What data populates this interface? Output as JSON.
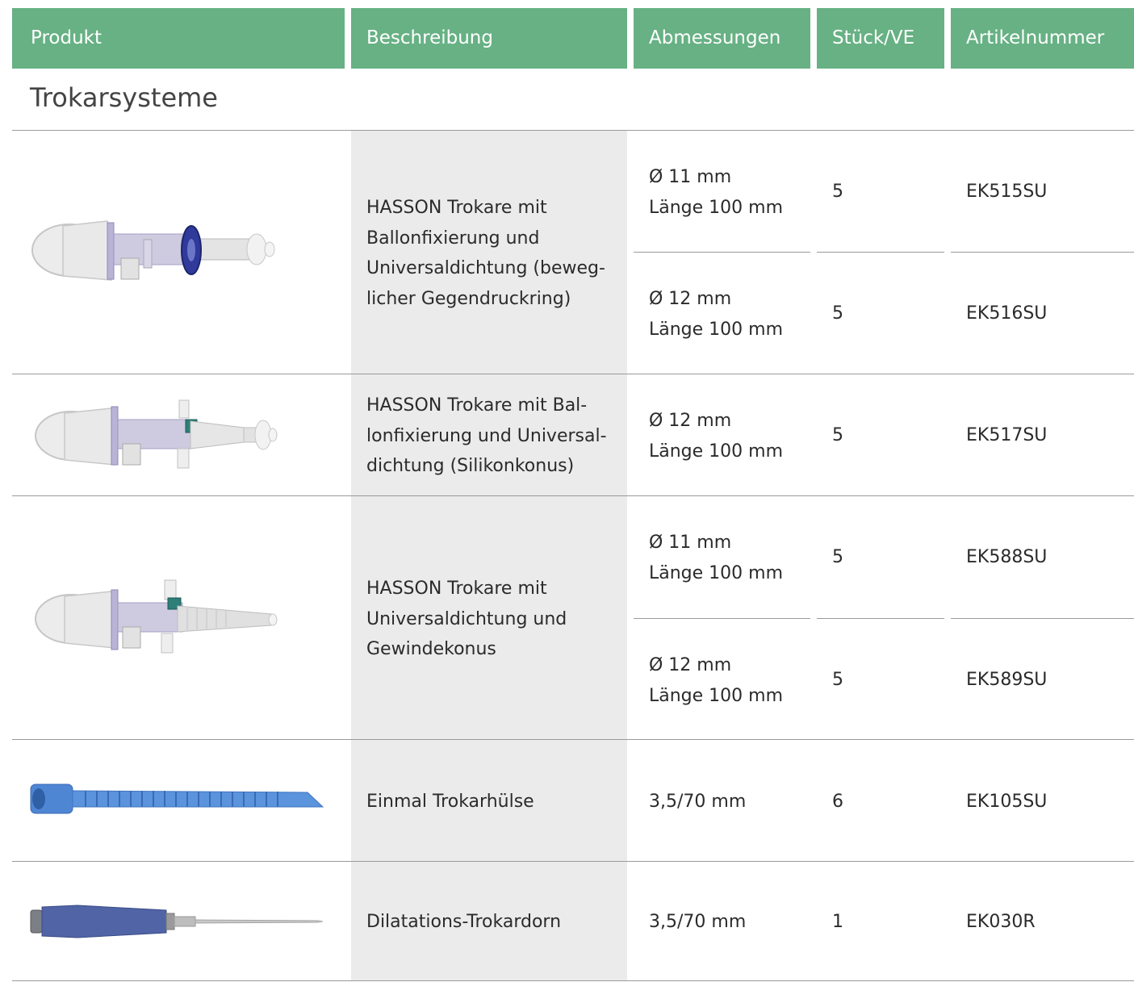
{
  "header": {
    "col_produkt": "Produkt",
    "col_beschreibung": "Beschreibung",
    "col_abmessungen": "Abmessungen",
    "col_stueck": "Stück/VE",
    "col_artikel": "Artikelnummer",
    "color": "#67b184"
  },
  "section": {
    "title": "Trokarsysteme"
  },
  "groups": [
    {
      "description": [
        "HASSON Trokare mit",
        "Ballonfixierung und",
        "Universaldichtung (beweg-",
        "licher Gegendruckring)"
      ],
      "image_icon": "hasson-trocar-blue-ring-icon",
      "rows": [
        {
          "dim1": "Ø 11 mm",
          "dim2": "Länge 100 mm",
          "qty": "5",
          "article": "EK515SU"
        },
        {
          "dim1": "Ø 12 mm",
          "dim2": "Länge 100 mm",
          "qty": "5",
          "article": "EK516SU"
        }
      ]
    },
    {
      "description": [
        "HASSON Trokare mit Bal-",
        "lonfixierung und Universal-",
        "dichtung (Silikonkonus)"
      ],
      "image_icon": "hasson-trocar-silicone-cone-icon",
      "rows": [
        {
          "dim1": "Ø 12 mm",
          "dim2": "Länge 100 mm",
          "qty": "5",
          "article": "EK517SU"
        }
      ]
    },
    {
      "description": [
        "HASSON Trokare mit",
        "Universaldichtung und",
        "Gewindekonus"
      ],
      "image_icon": "hasson-trocar-threaded-cone-icon",
      "rows": [
        {
          "dim1": "Ø 11 mm",
          "dim2": "Länge 100 mm",
          "qty": "5",
          "article": "EK588SU"
        },
        {
          "dim1": "Ø 12 mm",
          "dim2": "Länge 100 mm",
          "qty": "5",
          "article": "EK589SU"
        }
      ]
    },
    {
      "description": [
        "Einmal Trokarhülse"
      ],
      "image_icon": "trocar-sleeve-icon",
      "rows": [
        {
          "dim1": "3,5/70 mm",
          "qty": "6",
          "article": "EK105SU"
        }
      ]
    },
    {
      "description": [
        "Dilatations-Trokardorn"
      ],
      "image_icon": "dilatation-trocar-icon",
      "rows": [
        {
          "dim1": "3,5/70 mm",
          "qty": "1",
          "article": "EK030R"
        }
      ]
    }
  ]
}
